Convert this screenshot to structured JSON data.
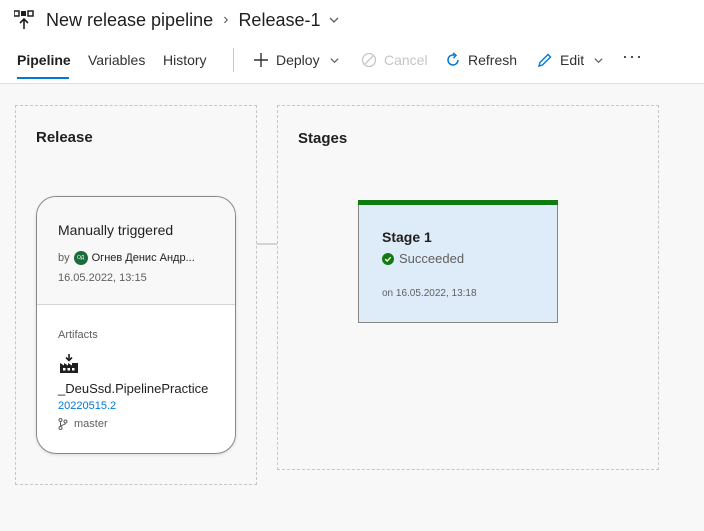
{
  "header": {
    "title": "New release pipeline",
    "release_name": "Release-1"
  },
  "tabs": [
    {
      "label": "Pipeline",
      "active": true
    },
    {
      "label": "Variables",
      "active": false
    },
    {
      "label": "History",
      "active": false
    }
  ],
  "toolbar": {
    "deploy_label": "Deploy",
    "cancel_label": "Cancel",
    "refresh_label": "Refresh",
    "edit_label": "Edit",
    "more_label": "···"
  },
  "release_panel": {
    "title": "Release",
    "card": {
      "trigger": "Manually triggered",
      "by_prefix": "by",
      "avatar_initials": "ОД",
      "user": "Огнев Денис Андр...",
      "date": "16.05.2022, 13:15",
      "artifacts_label": "Artifacts",
      "artifact_name": "_DeuSsd.PipelinePractice",
      "build": "20220515.2",
      "branch": "master"
    }
  },
  "stages_panel": {
    "title": "Stages",
    "stage": {
      "name": "Stage 1",
      "status": "Succeeded",
      "date": "on 16.05.2022, 13:18"
    }
  },
  "colors": {
    "accent": "#0078d4",
    "success": "#107c10",
    "stage_bg": "#deecf9"
  },
  "icons": {
    "pipeline": "release-pipeline-icon",
    "deploy": "plus-icon",
    "cancel": "cancel-circle-icon",
    "refresh": "refresh-icon",
    "edit": "pencil-icon",
    "artifact": "artifact-build-icon",
    "branch": "git-branch-icon",
    "status": "check-circle-icon"
  }
}
